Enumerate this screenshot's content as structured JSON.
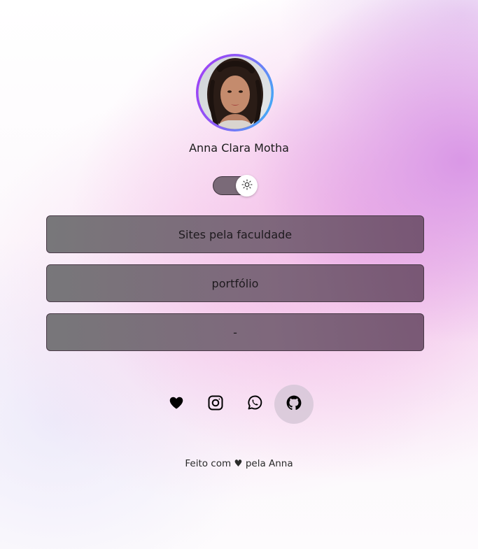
{
  "profile": {
    "name": "Anna Clara Motha"
  },
  "theme_toggle": {
    "state": "light",
    "icon": "sun-icon"
  },
  "links": [
    {
      "label": "Sites pela faculdade"
    },
    {
      "label": "portfólio"
    },
    {
      "label": "-"
    }
  ],
  "social": [
    {
      "icon": "heart-icon"
    },
    {
      "icon": "instagram-icon"
    },
    {
      "icon": "whatsapp-icon"
    },
    {
      "icon": "github-icon"
    }
  ],
  "footer": {
    "prefix": "Feito com",
    "heart": "♥",
    "suffix": "pela Anna"
  },
  "colors": {
    "avatar_ring_start": "#a23cf5",
    "avatar_ring_end": "#36b9f6",
    "button_fill": "#766774",
    "toggle_track": "#7a6a78",
    "github_hover": "#d2c4d4"
  }
}
